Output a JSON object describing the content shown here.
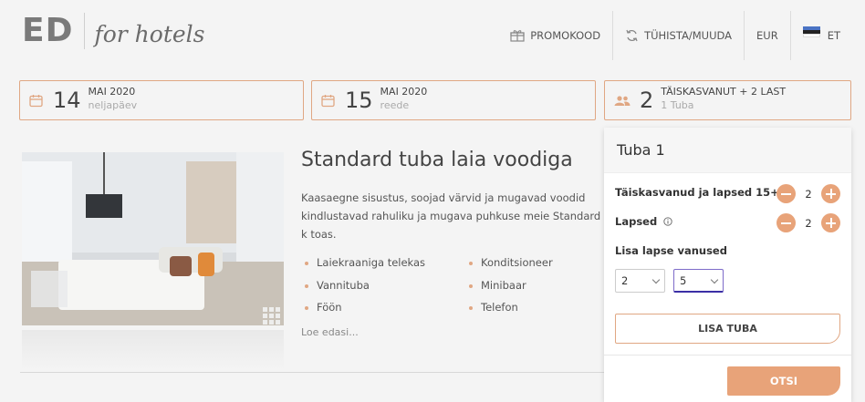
{
  "logo": {
    "main": "ED",
    "sub": "for hotels"
  },
  "nav": {
    "promo": "PROMOKOOD",
    "cancel": "TÜHISTA/MUUDA",
    "currency": "EUR",
    "language": "ET"
  },
  "booking": {
    "checkin": {
      "day": "14",
      "month": "MAI 2020",
      "weekday": "neljapäev"
    },
    "checkout": {
      "day": "15",
      "month": "MAI 2020",
      "weekday": "reede"
    },
    "guests": {
      "count": "2",
      "summary": "TÄISKASVANUT + 2 LAST",
      "rooms": "1 Tuba"
    }
  },
  "room": {
    "title": "Standard tuba laia voodiga",
    "description": "Kaasaegne sisustus, soojad värvid ja mugavad voodid kindlustavad rahuliku ja mugava puhkuse meie Standard k toas.",
    "amenities": [
      "Laiekraaniga telekas",
      "Konditsioneer",
      "Vannituba",
      "Minibaar",
      "Föön",
      "Telefon"
    ],
    "read_more": "Loe edasi..."
  },
  "panel": {
    "title": "Tuba 1",
    "adults_label": "Täiskasvanud ja lapsed 15+",
    "adults_value": "2",
    "children_label": "Lapsed",
    "children_value": "2",
    "child_ages_label": "Lisa lapse vanused",
    "child_ages": [
      "2",
      "5"
    ],
    "add_room": "LISA TUBA",
    "search": "OTSI"
  },
  "colors": {
    "accent": "#e8a379",
    "border": "#e0a783",
    "flag_blue": "#4a73c4",
    "flag_black": "#222222"
  },
  "icons": [
    "gift-icon",
    "refresh-icon",
    "estonia-flag-icon",
    "calendar-icon",
    "people-icon",
    "info-icon",
    "gallery-icon"
  ]
}
